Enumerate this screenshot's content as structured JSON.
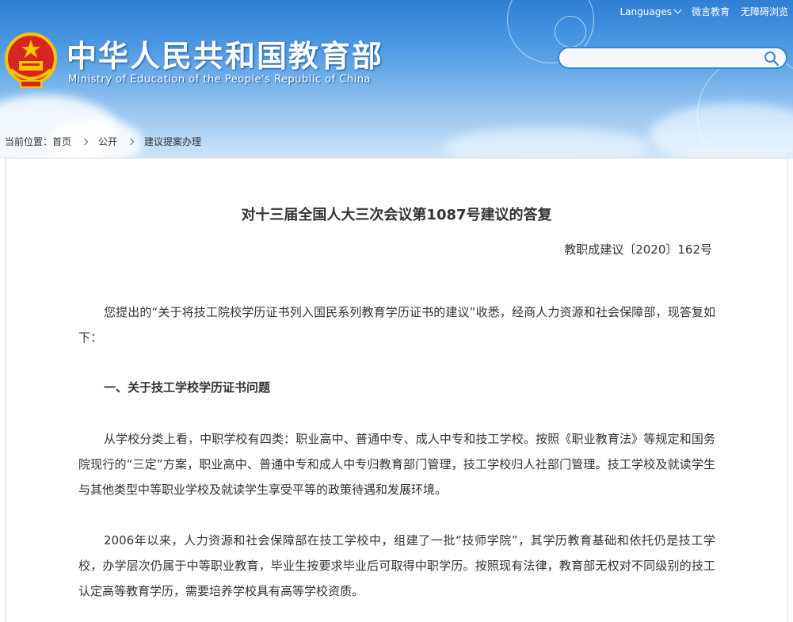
{
  "header": {
    "site_title_cn": "中华人民共和国教育部",
    "site_title_en": "Ministry of Education of the People's Republic of China",
    "top_links": {
      "languages": "Languages",
      "weiyan": "微言教育",
      "accessibility": "无障碍浏览"
    },
    "search": {
      "placeholder": "",
      "value": ""
    }
  },
  "breadcrumb": {
    "label": "当前位置：",
    "items": [
      "首页",
      "公开",
      "建议提案办理"
    ]
  },
  "article": {
    "title": "对十三届全国人大三次会议第1087号建议的答复",
    "doc_number": "教职成建议〔2020〕162号",
    "paragraph1": "您提出的“关于将技工院校学历证书列入国民系列教育学历证书的建议”收悉，经商人力资源和社会保障部，现答复如下：",
    "section1_heading": "一、关于技工学校学历证书问题",
    "paragraph2": "从学校分类上看，中职学校有四类：职业高中、普通中专、成人中专和技工学校。按照《职业教育法》等规定和国务院现行的“三定”方案，职业高中、普通中专和成人中专归教育部门管理，技工学校归人社部门管理。技工学校及就读学生与其他类型中等职业学校及就读学生享受平等的政策待遇和发展环境。",
    "paragraph3": "2006年以来，人力资源和社会保障部在技工学校中，组建了一批“技师学院”，其学历教育基础和依托仍是技工学校，办学层次仍属于中等职业教育，毕业生按要求毕业后可取得中职学历。按照现有法律，教育部无权对不同级别的技工认定高等教育学历，需要培养学校具有高等学校资质。"
  },
  "colors": {
    "header_top": "#2f7fd4",
    "header_bottom": "#cfe5f8",
    "emblem_red": "#d7261d",
    "emblem_gold": "#f7c600",
    "search_border": "#3b86cf"
  }
}
